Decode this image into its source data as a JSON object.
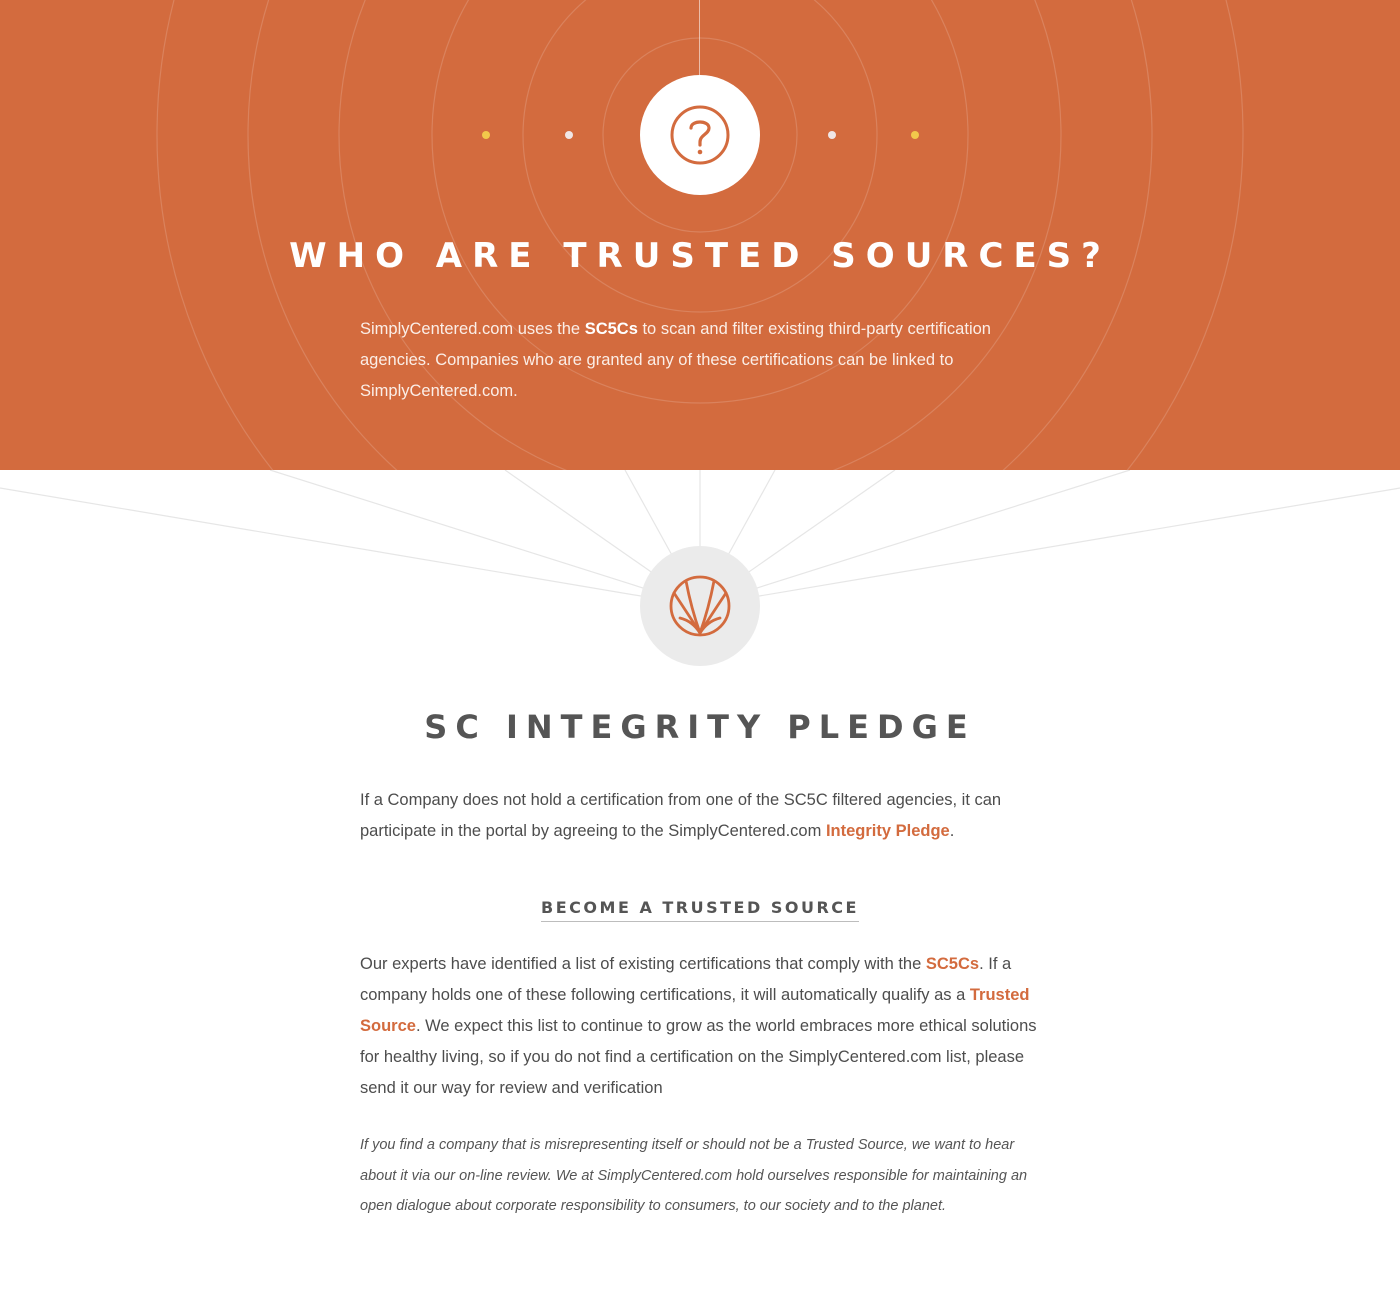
{
  "colors": {
    "accent": "#d36b3e",
    "hero_bg": "#d36b3e",
    "highlight_dot": "#f2c84b"
  },
  "hero": {
    "icon": "question-mark-icon",
    "title": "WHO ARE TRUSTED SOURCES?",
    "text": {
      "part1": "SimplyCentered.com uses the ",
      "bold": "SC5Cs",
      "part2": " to scan and filter existing third-party certification agencies. Companies who are granted any of these certifications can be linked to SimplyCentered.com."
    }
  },
  "pledge": {
    "icon": "leaf-logo-icon",
    "title": "SC INTEGRITY PLEDGE",
    "text": {
      "part1": "If a Company does not hold a certification from one of the SC5C filtered agencies, it can participate in the portal by agreeing to the SimplyCentered.com ",
      "link": "Integrity Pledge",
      "part2": "."
    }
  },
  "trusted": {
    "subhead": "BECOME A TRUSTED SOURCE",
    "text": {
      "part1": "Our experts have identified a list of existing certifications that comply with the ",
      "link1": "SC5Cs",
      "part2": ". If a company holds one of these following certifications, it will automatically qualify as a ",
      "link2": "Trusted Source",
      "part3": ". We expect this list to continue to grow as the world embraces more ethical solutions for healthy living, so if you do not find a certification on the SimplyCentered.com list, please send it our way for review and verification"
    },
    "note": "If you find a company that is misrepresenting itself or should not be a Trusted Source, we want to hear about it via our on-line review. We at SimplyCentered.com hold ourselves responsible for maintaining an open dialogue about corporate responsibility to consumers, to our society and to the planet."
  }
}
